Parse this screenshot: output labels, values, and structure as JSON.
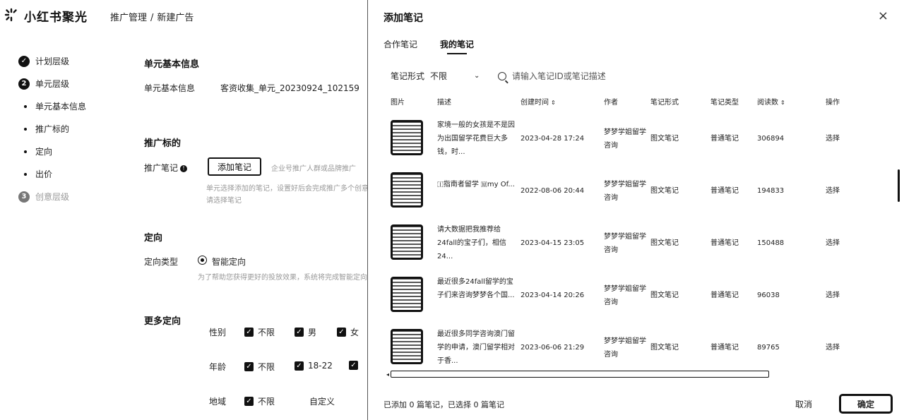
{
  "app": {
    "brand": "小红书聚光",
    "breadcrumb": [
      "推广管理",
      "新建广告"
    ]
  },
  "steps": [
    {
      "icon": "✓",
      "label": "计划层级"
    },
    {
      "icon": "2",
      "label": "单元层级"
    },
    {
      "label": "单元基本信息"
    },
    {
      "label": "推广标的"
    },
    {
      "label": "定向"
    },
    {
      "label": "出价"
    },
    {
      "icon": "3",
      "label": "创意层级"
    }
  ],
  "form": {
    "basic_title": "单元基本信息",
    "basic_label": "单元基本信息",
    "basic_value": "客资收集_单元_20230924_102159",
    "target_title": "推广标的",
    "note_label": "推广笔记",
    "add_note_button": "添加笔记",
    "note_hint_right": "企业号推广人群或品牌推广",
    "note_hint_1": "单元选择添加的笔记，设置好后会完成推广多个创意",
    "note_hint_2": "请选择笔记",
    "targeting_title": "定向",
    "targeting_type_label": "定向类型",
    "targeting_type_value": "智能定向",
    "targeting_hint": "为了帮助您获得更好的投放效果，系统将完成智能定向设置",
    "more_title": "更多定向",
    "gender_label": "性别",
    "gender_options": [
      "不限",
      "男",
      "女"
    ],
    "age_label": "年龄",
    "age_options": [
      "不限",
      "18-22"
    ],
    "region_label": "地域",
    "region_options": [
      "不限"
    ],
    "region_custom": "自定义"
  },
  "drawer": {
    "title": "添加笔记",
    "close": "×",
    "tabs": [
      "合作笔记",
      "我的笔记"
    ],
    "filter_label": "笔记形式",
    "filter_value": "不限",
    "search_placeholder": "请输入笔记ID或笔记描述",
    "columns": [
      "图片",
      "描述",
      "创建时间",
      "作者",
      "笔记形式",
      "笔记类型",
      "阅读数",
      "操作"
    ],
    "rows": [
      {
        "desc": "家境一般的女孩是不是因为出国留学花费巨大多钱，时...",
        "time": "2023-04-28 17:24",
        "author": "梦梦学姐留学咨询",
        "form": "图文笔记",
        "type": "普通笔记",
        "reads": "306894",
        "op": "选择"
      },
      {
        "desc": "🇮指南者留学 🇲my Of...",
        "time": "2022-08-06 20:44",
        "author": "梦梦学姐留学咨询",
        "form": "图文笔记",
        "type": "普通笔记",
        "reads": "194833",
        "op": "选择"
      },
      {
        "desc": "请大数据把我推荐给24fall的宝子们，相信24...",
        "time": "2023-04-15 23:05",
        "author": "梦梦学姐留学咨询",
        "form": "图文笔记",
        "type": "普通笔记",
        "reads": "150488",
        "op": "选择"
      },
      {
        "desc": "最近很多24fall留学的宝子们来咨询梦梦各个国...",
        "time": "2023-04-14 20:26",
        "author": "梦梦学姐留学咨询",
        "form": "图文笔记",
        "type": "普通笔记",
        "reads": "96038",
        "op": "选择"
      },
      {
        "desc": "最近很多同学咨询澳门留学的申请，澳门留学相对于香...",
        "time": "2023-06-06 21:29",
        "author": "梦梦学姐留学咨询",
        "form": "图文笔记",
        "type": "普通笔记",
        "reads": "89765",
        "op": "选择"
      }
    ],
    "footer_text": "已添加 0 篇笔记，已选择 0 篇笔记",
    "cancel": "取消",
    "ok": "确定"
  }
}
